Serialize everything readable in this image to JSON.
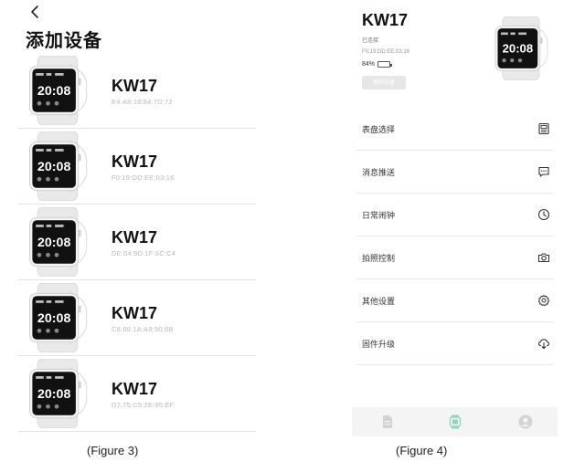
{
  "figure3": {
    "title": "添加设备",
    "watch_time": "20:08",
    "devices": [
      {
        "name": "KW17",
        "mac": "E4:A9:18:84:7D:72"
      },
      {
        "name": "KW17",
        "mac": "F0:19:DD:EE:03:16"
      },
      {
        "name": "KW17",
        "mac": "DE:04:9D:1F:6C:C4"
      },
      {
        "name": "KW17",
        "mac": "C8:89:1A:A9:90:6B"
      },
      {
        "name": "KW17",
        "mac": "D7:75:C5:2E:95:EF"
      }
    ],
    "caption": "(Figure 3)"
  },
  "figure4": {
    "model": "KW17",
    "status": "已连接",
    "mac": "F0:19:DD:EE:03:16",
    "battery_percent": "84%",
    "battery_level": 0.84,
    "unbind_label": "解绑设备",
    "watch_time": "20:08",
    "menu": [
      {
        "label": "表盘选择",
        "icon": "watch-face-icon"
      },
      {
        "label": "消息推送",
        "icon": "message-icon"
      },
      {
        "label": "日常闹钟",
        "icon": "clock-icon"
      },
      {
        "label": "拍照控制",
        "icon": "camera-icon"
      },
      {
        "label": "其他设置",
        "icon": "gear-icon"
      },
      {
        "label": "固件升级",
        "icon": "cloud-download-icon"
      }
    ],
    "tabs": [
      {
        "icon": "document-icon"
      },
      {
        "icon": "device-icon"
      },
      {
        "icon": "profile-icon"
      }
    ],
    "caption": "(Figure 4)"
  },
  "colors": {
    "accent": "#36b94a",
    "tab_active": "#8dd6bf",
    "tab_inactive": "#c9c9c9"
  }
}
